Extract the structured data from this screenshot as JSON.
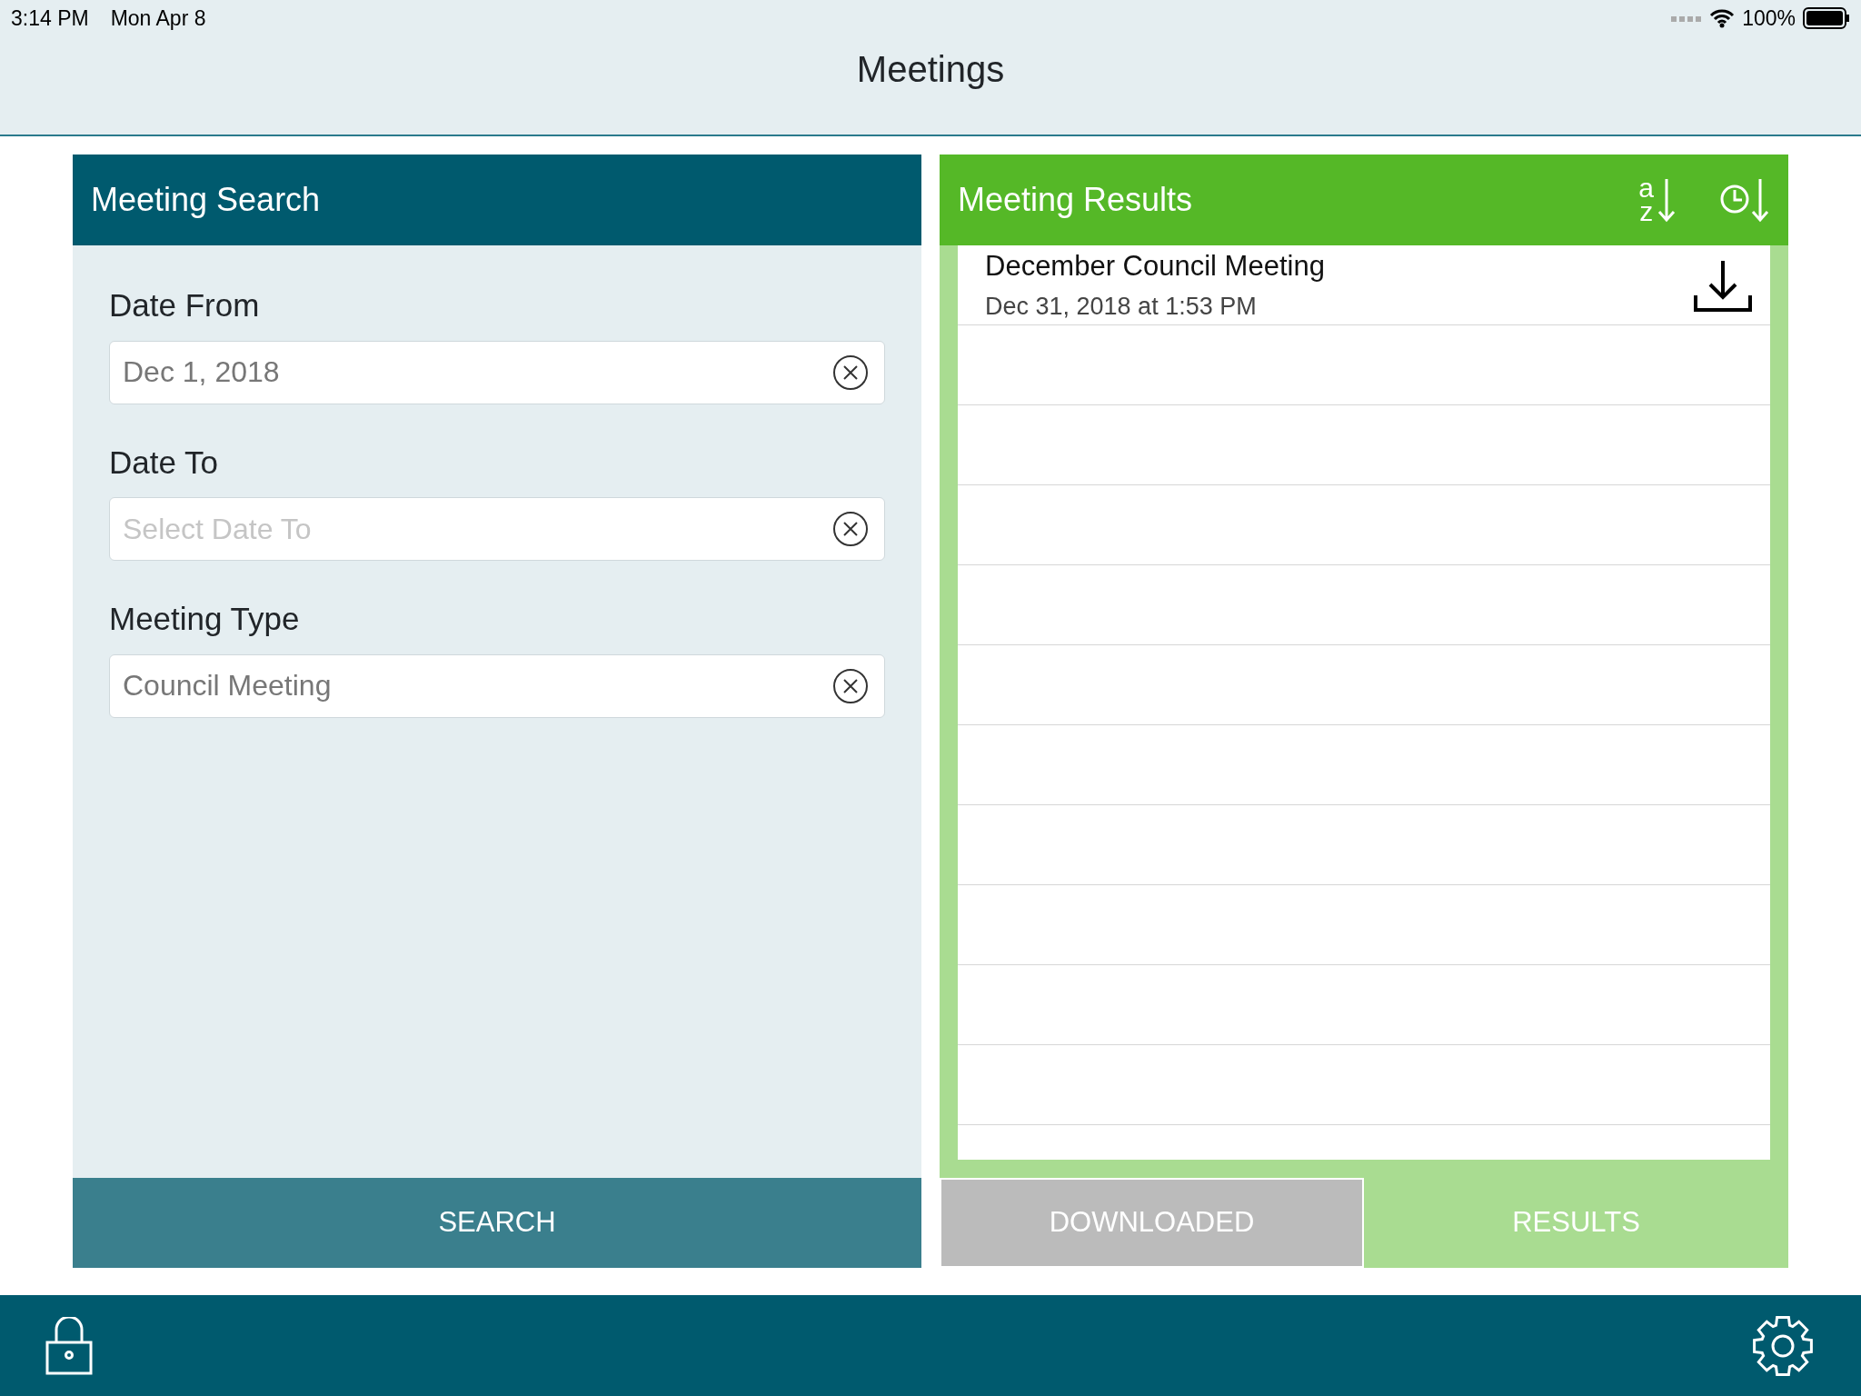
{
  "status_bar": {
    "time": "3:14 PM",
    "date": "Mon Apr 8",
    "battery": "100%"
  },
  "title": "Meetings",
  "search_panel": {
    "title": "Meeting Search",
    "fields": [
      {
        "label": "Date From",
        "value": "Dec 1, 2018"
      },
      {
        "label": "Date To",
        "placeholder": "Select Date To"
      },
      {
        "label": "Meeting Type",
        "value": "Council Meeting"
      }
    ],
    "button": "SEARCH"
  },
  "results_panel": {
    "title": "Meeting Results",
    "sort_buttons": [
      {
        "kind": "alpha",
        "letters": [
          "a",
          "z"
        ]
      },
      {
        "kind": "time"
      }
    ],
    "results": [
      {
        "title": "December Council Meeting",
        "date": "Dec 31, 2018 at 1:53 PM"
      }
    ],
    "tabs": [
      {
        "label": "DOWNLOADED",
        "selected": false
      },
      {
        "label": "RESULTS",
        "selected": true
      }
    ]
  }
}
